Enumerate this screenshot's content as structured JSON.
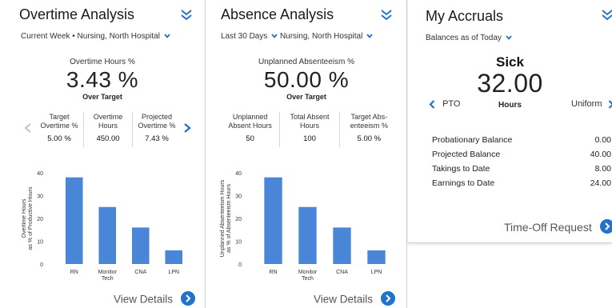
{
  "overtime": {
    "title": "Overtime Analysis",
    "filter": "Current Week • Nursing, North Hospital",
    "kpi_label": "Overtime Hours %",
    "kpi_value": "3.43 %",
    "kpi_sub": "Over Target",
    "metrics": [
      {
        "label": "Target Overtime %",
        "value": "5.00 %"
      },
      {
        "label": "Overtime Hours",
        "value": "450.00"
      },
      {
        "label": "Projected Overtime %",
        "value": "7.43 %"
      }
    ],
    "view_details": "View Details",
    "chart_data": {
      "type": "bar",
      "categories": [
        "RN",
        "Monitor Tech",
        "CNA",
        "LPN"
      ],
      "values": [
        38,
        25,
        16,
        6
      ],
      "ylabel": "Overtime Hours as % of Productive Hours",
      "ylim": [
        0,
        40
      ],
      "yticks": [
        0,
        10,
        20,
        30,
        40
      ],
      "bar_color": "#4a86d8"
    }
  },
  "absence": {
    "title": "Absence Analysis",
    "filter_period": "Last 30 Days",
    "filter_org": "Nursing, North Hospital",
    "kpi_label": "Unplanned Absenteeism %",
    "kpi_value": "50.00 %",
    "kpi_sub": "Over Target",
    "metrics": [
      {
        "label": "Unplanned Absent Hours",
        "value": "50"
      },
      {
        "label": "Total Absent Hours",
        "value": "100"
      },
      {
        "label": "Target Abs-enteeism %",
        "value": "5.00 %"
      }
    ],
    "view_details": "View Details",
    "chart_data": {
      "type": "bar",
      "categories": [
        "RN",
        "Monitor Tech",
        "CNA",
        "LPN"
      ],
      "values": [
        38,
        25,
        16,
        6
      ],
      "ylabel": "Unplanned Absenteeism Hours as % of Absenteeism Hours",
      "ylim": [
        0,
        40
      ],
      "yticks": [
        0,
        10,
        20,
        30,
        40
      ],
      "bar_color": "#4a86d8"
    }
  },
  "accruals": {
    "title": "My Accruals",
    "filter": "Balances as of Today",
    "type": "Sick",
    "value": "32.00",
    "unit": "Hours",
    "prev_label": "PTO",
    "next_label": "Uniform",
    "balances": [
      {
        "label": "Probationary Balance",
        "value": "0.00"
      },
      {
        "label": "Projected Balance",
        "value": "40.00"
      },
      {
        "label": "Takings to Date",
        "value": "8.00"
      },
      {
        "label": "Earnings to Date",
        "value": "24.00"
      }
    ],
    "timeoff_label": "Time-Off Request"
  },
  "colors": {
    "accent": "#2372c9",
    "bar": "#4a86d8"
  }
}
